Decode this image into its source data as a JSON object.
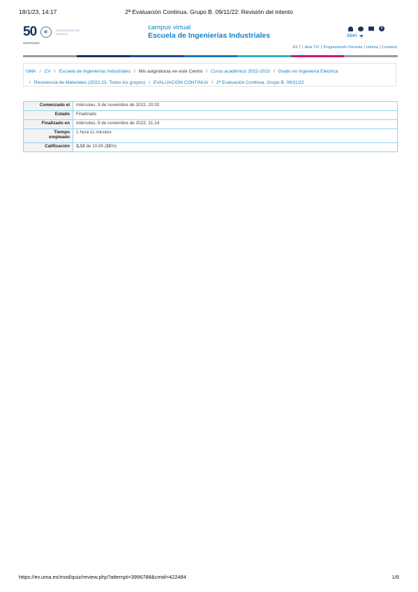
{
  "print_header": {
    "date": "18/1/23, 14:17",
    "title": "2ª Evaluación Continua. Grupo B. 09/11/22: Revisión del intento"
  },
  "print_footer": {
    "url": "https://ev.uma.es/mod/quiz/review.php?attempt=3996788&cmid=422484",
    "page": "1/6"
  },
  "logos": {
    "anniversary": "50",
    "anniversary_sub": "ANIVERSARIO",
    "university": "UNIVERSIDAD DE MÁLAGA"
  },
  "site": {
    "line1": "campus virtual",
    "line2": "Escuela de Ingenierías Industriales"
  },
  "user": {
    "name": "Abel"
  },
  "icons": [
    "bell-icon",
    "chat-icon",
    "mail-icon",
    "help-icon"
  ],
  "top_links": [
    "EII.T",
    "Aula TIC",
    "Programación Docente",
    "Idioma",
    "Contacto"
  ],
  "color_bar": [
    "#9a9a9a",
    "#16305f",
    "#1f4d8c",
    "#1e77b6",
    "#2aaed0",
    "#c21874",
    "#9a9a9a"
  ],
  "breadcrumb": [
    "UMA",
    "CV",
    "Escuela de Ingenierías Industriales",
    "Mis asignaturas en este Centro",
    "Curso académico 2022-2023",
    "Grado en Ingeniería Eléctrica",
    "Resistencia de Materiales (2022-23, Todos los grupos)",
    "EVALUACIÓN CONTINUA",
    "2ª Evaluación Continua. Grupo B. 09/11/22"
  ],
  "summary": {
    "started_label": "Comenzado el",
    "started_value": "miércoles, 9 de noviembre de 2022, 20:02",
    "state_label": "Estado",
    "state_value": "Finalizado",
    "finished_label": "Finalizado en",
    "finished_value": "miércoles, 9 de noviembre de 2022, 21:14",
    "time_label_1": "Tiempo",
    "time_label_2": "empleado",
    "time_value": "1 hora 11 minutos",
    "grade_label": "Calificación",
    "grade_score": "3,13",
    "grade_of": "de 10,00 (",
    "grade_percent": "31",
    "grade_end": "%)"
  }
}
